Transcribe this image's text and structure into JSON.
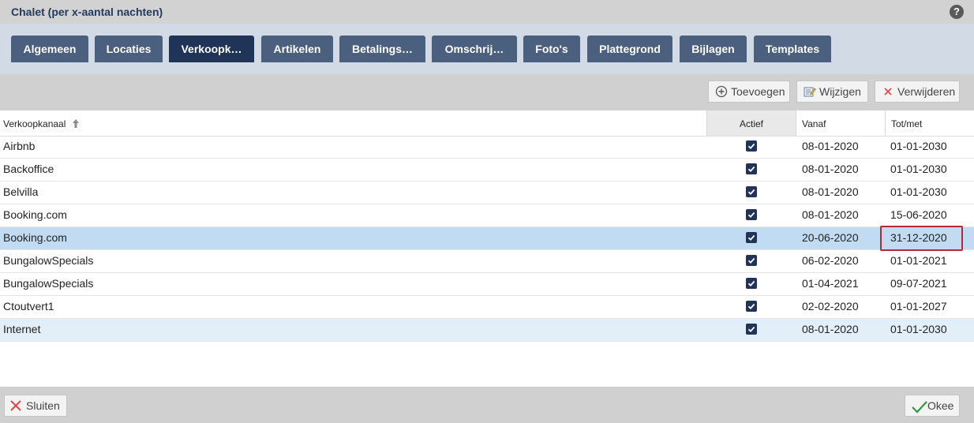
{
  "window": {
    "title": "Chalet (per x-aantal nachten)",
    "help_glyph": "?"
  },
  "tabs": [
    {
      "label": "Algemeen"
    },
    {
      "label": "Locaties"
    },
    {
      "label": "Verkoopk…",
      "active": true
    },
    {
      "label": "Artikelen"
    },
    {
      "label": "Betalings…"
    },
    {
      "label": "Omschrij…"
    },
    {
      "label": "Foto's"
    },
    {
      "label": "Plattegrond"
    },
    {
      "label": "Bijlagen"
    },
    {
      "label": "Templates"
    }
  ],
  "toolbar": {
    "add_label": "Toevoegen",
    "edit_label": "Wijzigen",
    "delete_label": "Verwijderen"
  },
  "table": {
    "columns": {
      "channel": "Verkoopkanaal",
      "active": "Actief",
      "from": "Vanaf",
      "until": "Tot/met"
    },
    "rows": [
      {
        "channel": "Airbnb",
        "active": true,
        "from": "08-01-2020",
        "until": "01-01-2030"
      },
      {
        "channel": "Backoffice",
        "active": true,
        "from": "08-01-2020",
        "until": "01-01-2030"
      },
      {
        "channel": "Belvilla",
        "active": true,
        "from": "08-01-2020",
        "until": "01-01-2030"
      },
      {
        "channel": "Booking.com",
        "active": true,
        "from": "08-01-2020",
        "until": "15-06-2020"
      },
      {
        "channel": "Booking.com",
        "active": true,
        "from": "20-06-2020",
        "until": "31-12-2020",
        "selected": true
      },
      {
        "channel": "BungalowSpecials",
        "active": true,
        "from": "06-02-2020",
        "until": "01-01-2021"
      },
      {
        "channel": "BungalowSpecials",
        "active": true,
        "from": "01-04-2021",
        "until": "09-07-2021"
      },
      {
        "channel": "Ctoutvert1",
        "active": true,
        "from": "02-02-2020",
        "until": "01-01-2027"
      },
      {
        "channel": "Internet",
        "active": true,
        "from": "08-01-2020",
        "until": "01-01-2030",
        "hovered": true
      }
    ]
  },
  "footer": {
    "close_label": "Sluiten",
    "ok_label": "Okee"
  },
  "colors": {
    "accent": "#1f3457",
    "tab": "#4b5f7e",
    "selected_row": "#c1dcf2",
    "highlight": "#b82a33"
  }
}
